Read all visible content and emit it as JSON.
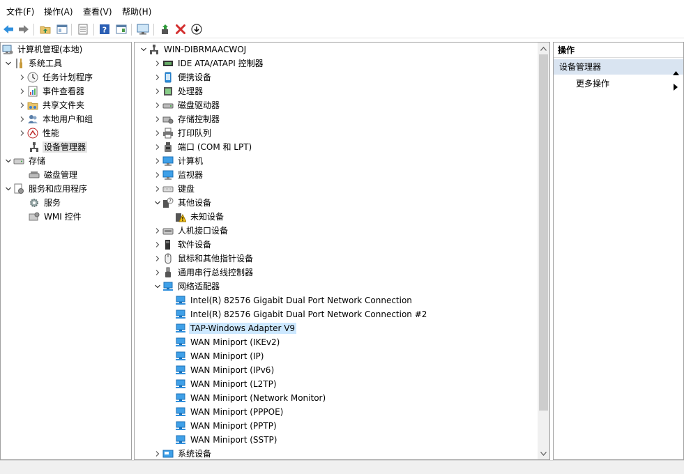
{
  "menu": [
    "文件(F)",
    "操作(A)",
    "查看(V)",
    "帮助(H)"
  ],
  "colors": {
    "accent_blue": "#2f8fdd",
    "red_x": "#d32f2f",
    "selected_blue": "#cce8ff",
    "section_bg": "#d9e4f1"
  },
  "toolbar": {
    "buttons": [
      "back-icon",
      "forward-icon",
      "up-folder-icon",
      "show-hide-tree-icon",
      "properties-icon",
      "help-icon",
      "show-action-pane-icon",
      "monitor-icon",
      "update-driver-icon",
      "uninstall-icon",
      "disable-device-icon"
    ]
  },
  "left_tree": {
    "items": [
      {
        "label": "计算机管理(本地)",
        "icon": "computer-management-icon"
      },
      {
        "label": "系统工具",
        "icon": "tools-icon"
      },
      {
        "label": "任务计划程序",
        "icon": "clock-icon"
      },
      {
        "label": "事件查看器",
        "icon": "event-viewer-icon"
      },
      {
        "label": "共享文件夹",
        "icon": "shared-folder-icon"
      },
      {
        "label": "本地用户和组",
        "icon": "users-icon"
      },
      {
        "label": "性能",
        "icon": "performance-icon"
      },
      {
        "label": "设备管理器",
        "icon": "device-manager-icon"
      },
      {
        "label": "存储",
        "icon": "storage-icon"
      },
      {
        "label": "磁盘管理",
        "icon": "disk-management-icon"
      },
      {
        "label": "服务和应用程序",
        "icon": "services-apps-icon"
      },
      {
        "label": "服务",
        "icon": "gear-icon"
      },
      {
        "label": "WMI 控件",
        "icon": "wmi-icon"
      }
    ]
  },
  "center_tree": {
    "root": "WIN-DIBRMAACWOJ",
    "categories": [
      "IDE ATA/ATAPI 控制器",
      "便携设备",
      "处理器",
      "磁盘驱动器",
      "存储控制器",
      "打印队列",
      "端口 (COM 和 LPT)",
      "计算机",
      "监视器",
      "键盘",
      "其他设备",
      "未知设备",
      "人机接口设备",
      "软件设备",
      "鼠标和其他指针设备",
      "通用串行总线控制器",
      "网络适配器",
      "Intel(R) 82576 Gigabit Dual Port Network Connection",
      "Intel(R) 82576 Gigabit Dual Port Network Connection #2",
      "TAP-Windows Adapter V9",
      "WAN Miniport (IKEv2)",
      "WAN Miniport (IP)",
      "WAN Miniport (IPv6)",
      "WAN Miniport (L2TP)",
      "WAN Miniport (Network Monitor)",
      "WAN Miniport (PPPOE)",
      "WAN Miniport (PPTP)",
      "WAN Miniport (SSTP)",
      "系统设备"
    ]
  },
  "actions": {
    "title": "操作",
    "section": "设备管理器",
    "more": "更多操作"
  }
}
